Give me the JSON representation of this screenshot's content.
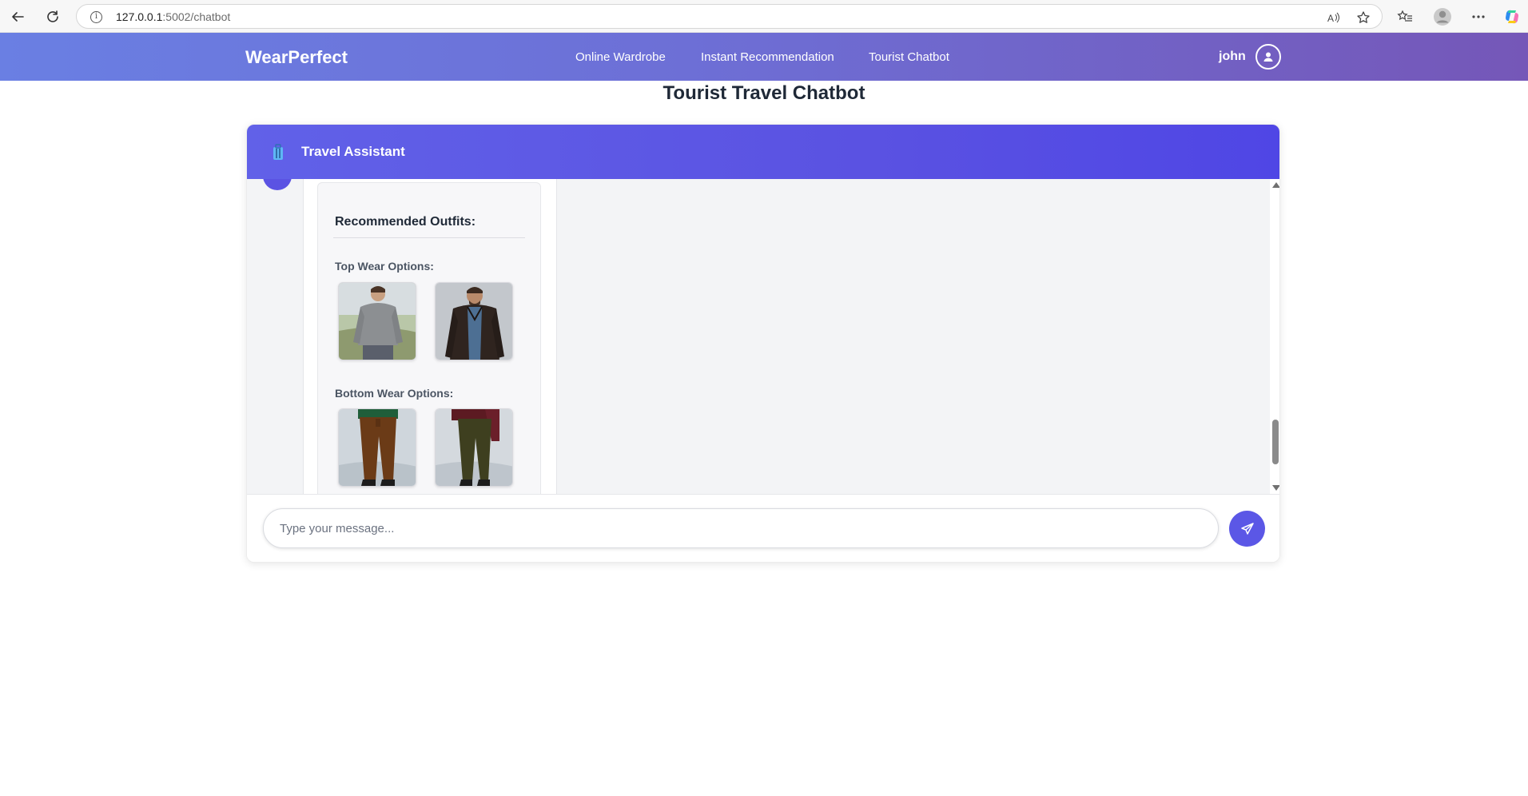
{
  "browser": {
    "url_host": "127.0.0.1",
    "url_rest": ":5002/chatbot"
  },
  "navbar": {
    "brand": "WearPerfect",
    "links": [
      "Online Wardrobe",
      "Instant Recommendation",
      "Tourist Chatbot"
    ],
    "user": "john"
  },
  "page": {
    "title": "Tourist Travel Chatbot"
  },
  "chat": {
    "header_title": "Travel Assistant",
    "outfits_title": "Recommended Outfits:",
    "top_wear_label": "Top Wear Options:",
    "bottom_wear_label": "Bottom Wear Options:",
    "input_placeholder": "Type your message..."
  },
  "colors": {
    "nav_start": "#6a7fe3",
    "nav_end": "#7557b8",
    "chat_header": "#5a52e2",
    "send_button": "#5b57e6"
  }
}
